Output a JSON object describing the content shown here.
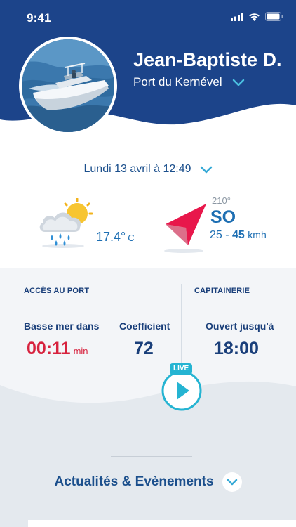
{
  "status": {
    "time": "9:41"
  },
  "user": {
    "name": "Jean-Baptiste D.",
    "port": "Port du Kernével"
  },
  "date": {
    "label": "Lundi 13 avril à 12:49"
  },
  "weather": {
    "temperature": "17.4°",
    "unit": "C",
    "icon": "partly-cloudy-rain-icon"
  },
  "wind": {
    "degrees": "210°",
    "direction": "SO",
    "speed_min": "25",
    "separator": "-",
    "speed_max": "45",
    "unit": "kmh",
    "icon": "wind-direction-arrow-icon"
  },
  "port_access": {
    "section_label": "ACCÈS AU PORT",
    "low_tide_label": "Basse mer dans",
    "low_tide_value": "00:11",
    "low_tide_unit": "min",
    "coefficient_label": "Coefficient",
    "coefficient_value": "72"
  },
  "harbour_office": {
    "section_label": "CAPITAINERIE",
    "open_label": "Ouvert jusqu'à",
    "open_value": "18:00"
  },
  "live": {
    "label": "LIVE"
  },
  "news": {
    "title": "Actualités & Evènements"
  },
  "colors": {
    "header_blue": "#1c448a",
    "accent_red": "#d7223e",
    "accent_cyan": "#25b4d2",
    "text_blue": "#1a3f7a"
  }
}
